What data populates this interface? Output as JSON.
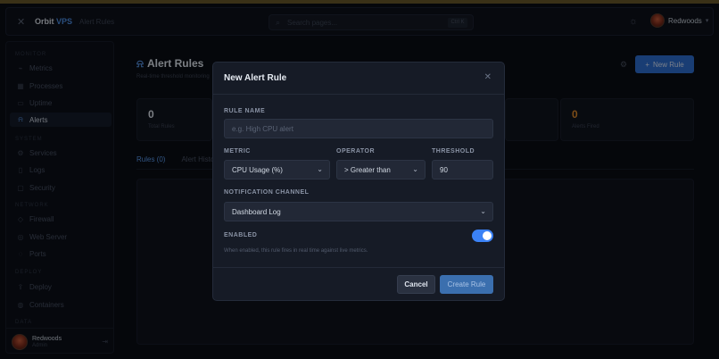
{
  "app": {
    "brand_a": "Orbit",
    "brand_b": "VPS",
    "breadcrumb": "Alert Rules"
  },
  "search": {
    "placeholder": "Search pages...",
    "shortcut": "Ctrl K"
  },
  "user": {
    "name": "Redwoods",
    "role": "Admin"
  },
  "sidebar": {
    "sections": [
      "MONITOR",
      "SYSTEM",
      "NETWORK",
      "DEPLOY",
      "DATA"
    ],
    "items": [
      {
        "label": "Metrics",
        "icon": "chart-icon"
      },
      {
        "label": "Processes",
        "icon": "grid-icon"
      },
      {
        "label": "Uptime",
        "icon": "pulse-icon"
      },
      {
        "label": "Alerts",
        "icon": "bell-icon",
        "active": true
      },
      {
        "label": "Services",
        "icon": "gear-icon"
      },
      {
        "label": "Logs",
        "icon": "file-icon"
      },
      {
        "label": "Security",
        "icon": "lock-icon"
      },
      {
        "label": "Firewall",
        "icon": "shield-icon"
      },
      {
        "label": "Web Server",
        "icon": "globe-icon"
      },
      {
        "label": "Ports",
        "icon": "plug-icon"
      },
      {
        "label": "Deploy",
        "icon": "upload-icon"
      },
      {
        "label": "Containers",
        "icon": "box-icon"
      }
    ]
  },
  "page": {
    "title": "Alert Rules",
    "subtitle": "Real-time threshold monitoring",
    "new_button": "New Rule",
    "cards": [
      {
        "value": "0",
        "label": "Total Rules",
        "color": "#dfe5ee"
      },
      {
        "value": "0",
        "label": "Alerts Fired",
        "color": "#e08a2a"
      }
    ],
    "tabs": [
      "Rules (0)",
      "Alert History"
    ]
  },
  "modal": {
    "title": "New Alert Rule",
    "rule_name_label": "RULE NAME",
    "rule_name_placeholder": "e.g. High CPU alert",
    "metric_label": "METRIC",
    "metric_value": "CPU Usage (%)",
    "operator_label": "OPERATOR",
    "operator_value": "> Greater than",
    "threshold_label": "THRESHOLD",
    "threshold_value": "90",
    "channel_label": "NOTIFICATION CHANNEL",
    "channel_value": "Dashboard Log",
    "enabled_label": "ENABLED",
    "enabled": true,
    "hint": "When enabled, this rule fires in real time against live metrics.",
    "cancel": "Cancel",
    "create": "Create Rule"
  },
  "colors": {
    "accent": "#3b82f6",
    "warning": "#e08a2a"
  }
}
